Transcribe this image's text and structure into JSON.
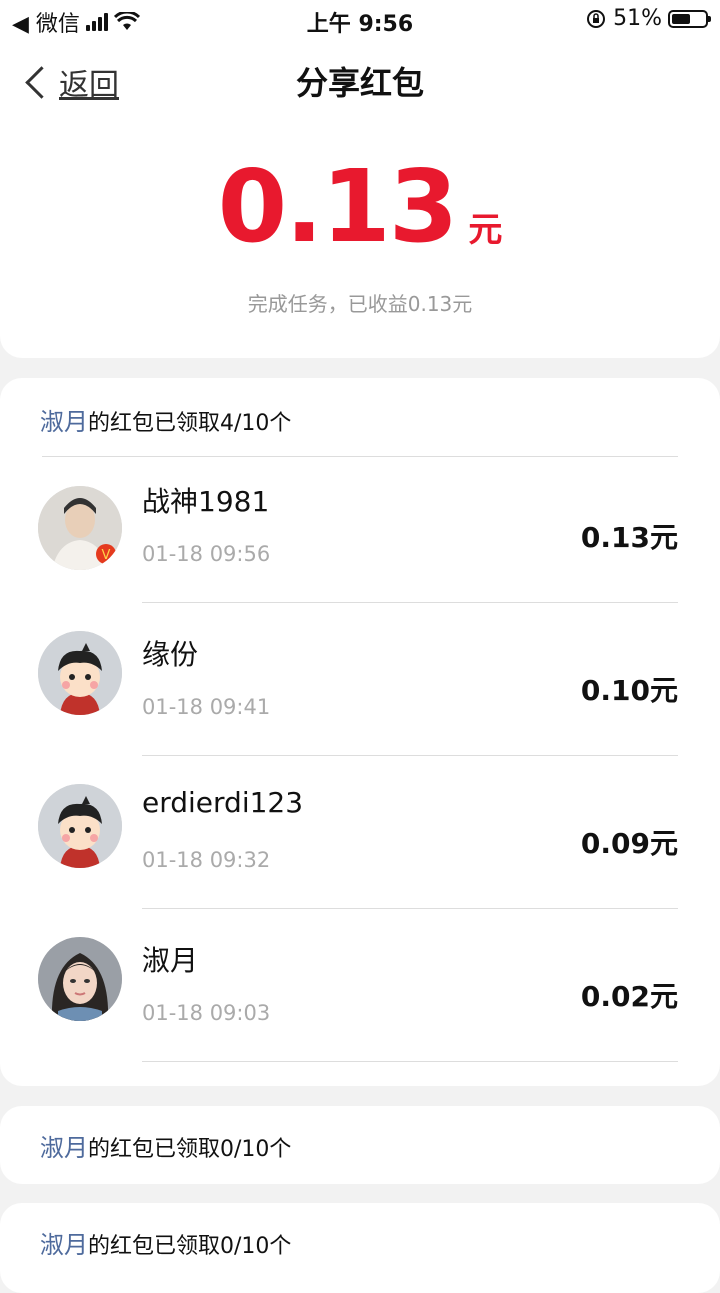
{
  "status_bar": {
    "back_app": "◀ 微信",
    "time": "上午 9:56",
    "battery": "51%"
  },
  "nav": {
    "back_label": "返回",
    "title": "分享红包"
  },
  "summary": {
    "amount": "0.13",
    "unit": "元",
    "subtitle": "完成任务，已收益0.13元"
  },
  "packets": [
    {
      "owner": "淑月",
      "status": "的红包已领取4/10个",
      "records": [
        {
          "name": "战神1981",
          "time": "01-18 09:56",
          "amount": "0.13元"
        },
        {
          "name": "缘份",
          "time": "01-18 09:41",
          "amount": "0.10元"
        },
        {
          "name": "erdierdi123",
          "time": "01-18 09:32",
          "amount": "0.09元"
        },
        {
          "name": "淑月",
          "time": "01-18 09:03",
          "amount": "0.02元"
        }
      ]
    },
    {
      "owner": "淑月",
      "status": "的红包已领取0/10个"
    },
    {
      "owner": "淑月",
      "status": "的红包已领取0/10个"
    }
  ],
  "colors": {
    "accent_red": "#e8192e",
    "name_blue": "#4e6a9c"
  }
}
